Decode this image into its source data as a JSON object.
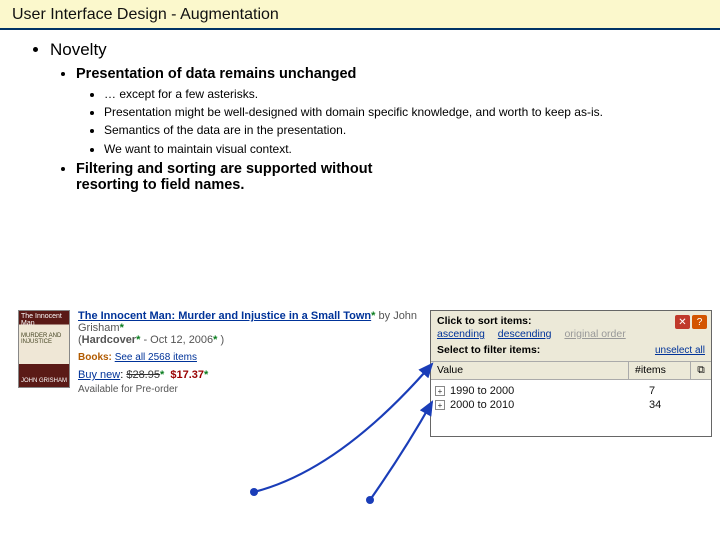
{
  "title": "User Interface Design - Augmentation",
  "bullets": {
    "lvl1": "Novelty",
    "lvl2a": "Presentation of data remains unchanged",
    "lvl3": [
      "… except for a few asterisks.",
      "Presentation might be well-designed with domain specific knowledge, and worth to keep as-is.",
      "Semantics of the data are in the presentation.",
      "We want to maintain visual context."
    ],
    "lvl2b": "Filtering and sorting are supported without resorting to field names."
  },
  "book": {
    "thumb_top": "The Innocent Man",
    "thumb_mid": "MURDER AND INJUSTICE",
    "thumb_bot": "JOHN GRISHAM",
    "title": "The Innocent Man: Murder and Injustice in a Small Town",
    "by_word": " by ",
    "author": "John Grisham",
    "paren_open": "(",
    "format": "Hardcover",
    "dash": " - ",
    "date": "Oct 12, 2006",
    "paren_close": " )",
    "books_label": "Books:",
    "see_all": "See all 2568 items",
    "buy_label": "Buy new",
    "colon": ": ",
    "old_price": "$28.95",
    "new_price": "$17.37",
    "avail": "Available for Pre-order",
    "asterisk": "*"
  },
  "panel": {
    "sort_heading": "Click to sort items:",
    "sort_asc": "ascending",
    "sort_desc": "descending",
    "sort_orig": "original order",
    "filter_heading": "Select to filter items:",
    "unselect": "unselect all",
    "col_value": "Value",
    "col_items": "#items",
    "col_icon": "⧉",
    "rows": [
      {
        "label": "1990 to 2000",
        "count": "7"
      },
      {
        "label": "2000 to 2010",
        "count": "34"
      }
    ],
    "close_glyph": "✕",
    "help_glyph": "?"
  }
}
